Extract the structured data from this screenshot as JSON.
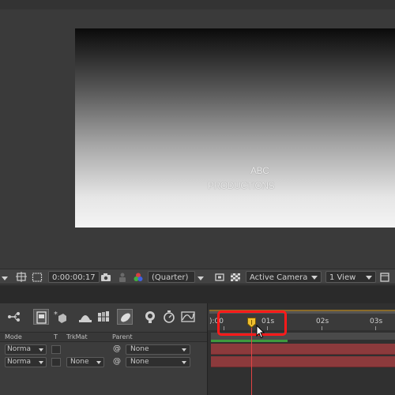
{
  "composition": {
    "title_line1": "ABC",
    "title_line2": "PRODUCTIONS"
  },
  "viewer_toolbar": {
    "timecode": "0:00:00:17",
    "resolution": "(Quarter)",
    "camera": "Active Camera",
    "views": "1 View"
  },
  "timeline": {
    "columns": {
      "mode": "Mode",
      "t": "T",
      "trkmat": "TrkMat",
      "parent": "Parent"
    },
    "layers": [
      {
        "mode": "Norma",
        "trkmat": "",
        "parent": "None"
      },
      {
        "mode": "Norma",
        "trkmat": "None",
        "parent": "None"
      }
    ],
    "ruler": {
      "start_label": "):00",
      "labels": [
        "01s",
        "02s",
        "03s"
      ]
    }
  },
  "colors": {
    "highlight": "#ff1a1a",
    "layer_bar": "#8c3a3c",
    "cti": "#e04444",
    "work_area": "#3e9a3e"
  }
}
